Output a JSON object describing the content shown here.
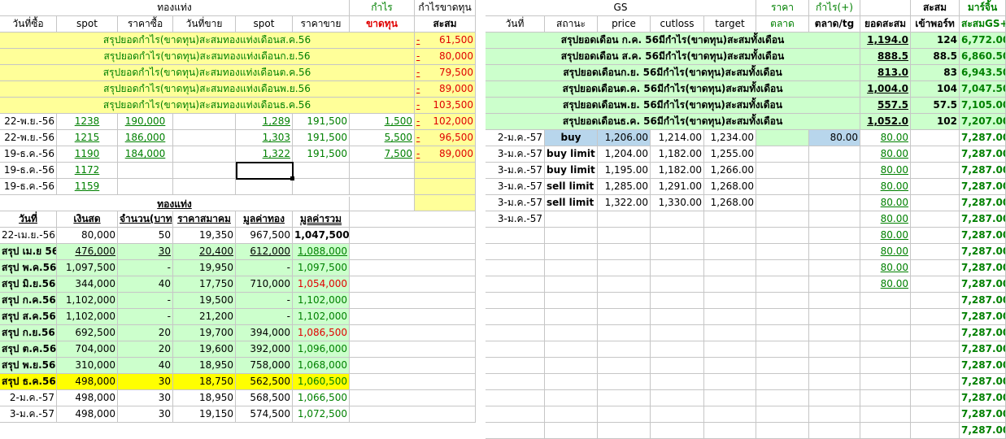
{
  "left": {
    "header_top": {
      "gold_bar": "ทองแท่ง",
      "profit": "กำไร",
      "cum_profit": "กำไรขาดทุน"
    },
    "header_cols": [
      "วันที่ซื้อ",
      "spot",
      "ราคาซื้อ",
      "วันที่ขาย",
      "spot",
      "ราคาขาย",
      "ขาดทุน",
      "สะสม"
    ],
    "month_summaries": [
      {
        "label": "สรุปยอดกำไร(ขาดทุน)สะสมทองแท่งเดือนส.ค.56",
        "value": "61,500"
      },
      {
        "label": "สรุปยอดกำไร(ขาดทุน)สะสมทองแท่งเดือนก.ย.56",
        "value": "80,000"
      },
      {
        "label": "สรุปยอดกำไร(ขาดทุน)สะสมทองแท่งเดือนต.ค.56",
        "value": "79,500"
      },
      {
        "label": "สรุปยอดกำไร(ขาดทุน)สะสมทองแท่งเดือนพ.ย.56",
        "value": "89,000"
      },
      {
        "label": "สรุปยอดกำไร(ขาดทุน)สะสมทองแท่งเดือนธ.ค.56",
        "value": "103,500"
      }
    ],
    "dash": "-",
    "trades": [
      {
        "date": "22-พ.ย.-56",
        "spot": "1238",
        "buy": "190,000",
        "sdate": "",
        "sspot": "1,289",
        "sell": "191,500",
        "profit": "1,500",
        "cum": "102,000"
      },
      {
        "date": "22-พ.ย.-56",
        "spot": "1215",
        "buy": "186,000",
        "sdate": "",
        "sspot": "1,303",
        "sell": "191,500",
        "profit": "5,500",
        "cum": "96,500"
      },
      {
        "date": "19-ธ.ค.-56",
        "spot": "1190",
        "buy": "184,000",
        "sdate": "",
        "sspot": "1,322",
        "sell": "191,500",
        "profit": "7,500",
        "cum": "89,000"
      },
      {
        "date": "19-ธ.ค.-56",
        "spot": "1172",
        "buy": "",
        "sdate": "",
        "sspot": "",
        "sell": "",
        "profit": "",
        "cum": ""
      },
      {
        "date": "19-ธ.ค.-56",
        "spot": "1159",
        "buy": "",
        "sdate": "",
        "sspot": "",
        "sell": "",
        "profit": "",
        "cum": ""
      }
    ],
    "section_title": "ทองแท่ง",
    "sub_header": [
      "วันที่",
      "เงินสด",
      "จำนวน(บาท)",
      "ราคาสมาคม",
      "มูลค่าทอง",
      "มูลค่ารวม"
    ],
    "holdings": [
      {
        "date": "22-เม.ย.-56",
        "cash": "80,000",
        "qty": "50",
        "price": "19,350",
        "gold": "967,500",
        "total": "1,047,500",
        "style": "plain"
      },
      {
        "date": "สรุป เม.ย 56",
        "cash": "476,000",
        "qty": "30",
        "price": "20,400",
        "gold": "612,000",
        "total": "1,088,000",
        "style": "green"
      },
      {
        "date": "สรุป พ.ค.56",
        "cash": "1,097,500",
        "qty": "-",
        "price": "19,950",
        "gold": "-",
        "total": "1,097,500",
        "style": "green"
      },
      {
        "date": "สรุป มิ.ย.56",
        "cash": "344,000",
        "qty": "40",
        "price": "17,750",
        "gold": "710,000",
        "total": "1,054,000",
        "style": "green-red"
      },
      {
        "date": "สรุป ก.ค.56",
        "cash": "1,102,000",
        "qty": "-",
        "price": "19,500",
        "gold": "-",
        "total": "1,102,000",
        "style": "green"
      },
      {
        "date": "สรุป ส.ค.56",
        "cash": "1,102,000",
        "qty": "-",
        "price": "21,200",
        "gold": "-",
        "total": "1,102,000",
        "style": "green"
      },
      {
        "date": "สรุป ก.ย.56",
        "cash": "692,500",
        "qty": "20",
        "price": "19,700",
        "gold": "394,000",
        "total": "1,086,500",
        "style": "green-red"
      },
      {
        "date": "สรุป ต.ค.56",
        "cash": "704,000",
        "qty": "20",
        "price": "19,600",
        "gold": "392,000",
        "total": "1,096,000",
        "style": "green"
      },
      {
        "date": "สรุป พ.ย.56",
        "cash": "310,000",
        "qty": "40",
        "price": "18,950",
        "gold": "758,000",
        "total": "1,068,000",
        "style": "green"
      },
      {
        "date": "สรุป ธ.ค.56",
        "cash": "498,000",
        "qty": "30",
        "price": "18,750",
        "gold": "562,500",
        "total": "1,060,500",
        "style": "yellow"
      },
      {
        "date": "2-ม.ค.-57",
        "cash": "498,000",
        "qty": "30",
        "price": "18,950",
        "gold": "568,500",
        "total": "1,066,500",
        "style": "plain"
      },
      {
        "date": "3-ม.ค.-57",
        "cash": "498,000",
        "qty": "30",
        "price": "19,150",
        "gold": "574,500",
        "total": "1,072,500",
        "style": "plain"
      }
    ]
  },
  "right": {
    "header_top": {
      "gs": "GS",
      "price": "ราคา",
      "profit": "กำไร(+)",
      "cum": "สะสม",
      "margin": "มาร์จิ้น"
    },
    "header_cols": [
      "วันที่",
      "สถานะ",
      "price",
      "cutloss",
      "target",
      "ตลาด",
      "ตลาด/tg",
      "ยอดสะสม",
      "เข้าพอร์ท",
      "สะสมGS+"
    ],
    "month_summaries": [
      {
        "label": "สรุปยอดเดือน ก.ค. 56มีกำไร(ขาดทุน)สะสมทั้งเดือน",
        "cum": "1,194.0",
        "port": "124",
        "total": "6,772.00"
      },
      {
        "label": "สรุปยอดเดือน ส.ค. 56มีกำไร(ขาดทุน)สะสมทั้งเดือน",
        "cum": "888.5",
        "port": "88.5",
        "total": "6,860.50"
      },
      {
        "label": "สรุปยอดเดือนก.ย. 56มีกำไร(ขาดทุน)สะสมทั้งเดือน",
        "cum": "813.0",
        "port": "83",
        "total": "6,943.50"
      },
      {
        "label": "สรุปยอดเดือนต.ค. 56มีกำไร(ขาดทุน)สะสมทั้งเดือน",
        "cum": "1,004.0",
        "port": "104",
        "total": "7,047.50"
      },
      {
        "label": "สรุปยอดเดือนพ.ย. 56มีกำไร(ขาดทุน)สะสมทั้งเดือน",
        "cum": "557.5",
        "port": "57.5",
        "total": "7,105.00"
      },
      {
        "label": "สรุปยอดเดือนธ.ค. 56มีกำไร(ขาดทุน)สะสมทั้งเดือน",
        "cum": "1,052.0",
        "port": "102",
        "total": "7,207.00"
      }
    ],
    "orders": [
      {
        "date": "2-ม.ค.-57",
        "status": "buy",
        "price": "1,206.00",
        "cutloss": "1,214.00",
        "target": "1,234.00",
        "market": "",
        "mtg": "80.00",
        "cum": "80.00",
        "port": "",
        "total": "7,287.00"
      },
      {
        "date": "3-ม.ค.-57",
        "status": "buy limit",
        "price": "1,204.00",
        "cutloss": "1,182.00",
        "target": "1,255.00",
        "market": "",
        "mtg": "",
        "cum": "80.00",
        "port": "",
        "total": "7,287.00"
      },
      {
        "date": "3-ม.ค.-57",
        "status": "buy limit",
        "price": "1,195.00",
        "cutloss": "1,182.00",
        "target": "1,266.00",
        "market": "",
        "mtg": "",
        "cum": "80.00",
        "port": "",
        "total": "7,287.00"
      },
      {
        "date": "3-ม.ค.-57",
        "status": "sell limit",
        "price": "1,285.00",
        "cutloss": "1,291.00",
        "target": "1,268.00",
        "market": "",
        "mtg": "",
        "cum": "80.00",
        "port": "",
        "total": "7,287.00"
      },
      {
        "date": "3-ม.ค.-57",
        "status": "sell limit",
        "price": "1,322.00",
        "cutloss": "1,330.00",
        "target": "1,268.00",
        "market": "",
        "mtg": "",
        "cum": "80.00",
        "port": "",
        "total": "7,287.00"
      },
      {
        "date": "3-ม.ค.-57",
        "status": "",
        "price": "",
        "cutloss": "",
        "target": "",
        "market": "",
        "mtg": "",
        "cum": "80.00",
        "port": "",
        "total": "7,287.00"
      }
    ],
    "extra_cum": [
      "80.00",
      "80.00",
      "80.00",
      "80.00"
    ],
    "total_value": "7,287.00"
  }
}
